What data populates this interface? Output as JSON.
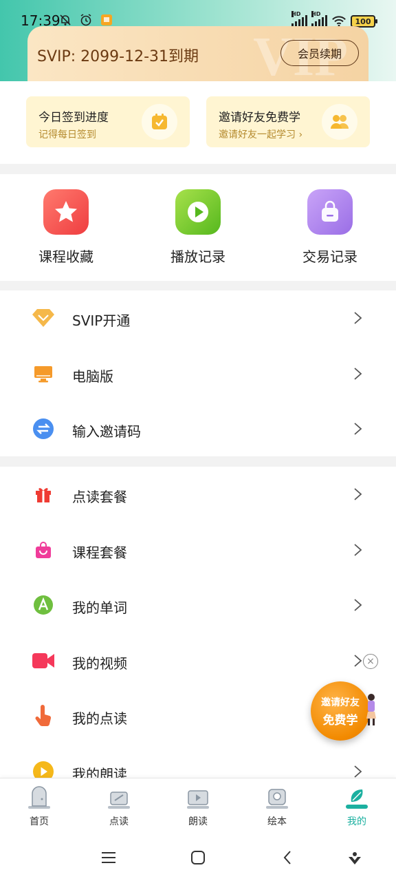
{
  "status_bar": {
    "time": "17:39",
    "hd1": "HD",
    "hd2": "HD",
    "battery": "100"
  },
  "vip": {
    "text": "SVIP: 2099-12-31到期",
    "watermark": "VIP",
    "renew_label": "会员续期"
  },
  "cards": [
    {
      "title": "今日签到进度",
      "sub": "记得每日签到",
      "icon": "calendar-check-icon"
    },
    {
      "title": "邀请好友免费学",
      "sub": "邀请好友一起学习 ›",
      "icon": "friends-icon"
    }
  ],
  "shortcuts": [
    {
      "label": "课程收藏",
      "icon": "star-icon",
      "color": "#f2554f"
    },
    {
      "label": "播放记录",
      "icon": "play-icon",
      "color": "#7fce2e"
    },
    {
      "label": "交易记录",
      "icon": "bag-icon",
      "color": "#b486ee"
    }
  ],
  "menu1": [
    {
      "label": "SVIP开通",
      "icon": "diamond-icon",
      "color": "#f5b84a"
    },
    {
      "label": "电脑版",
      "icon": "monitor-icon",
      "color": "#f59a2a"
    },
    {
      "label": "输入邀请码",
      "icon": "swap-icon",
      "color": "#4a8ff0"
    }
  ],
  "menu2": [
    {
      "label": "点读套餐",
      "icon": "gift-icon",
      "color": "#ef3b33"
    },
    {
      "label": "课程套餐",
      "icon": "shopping-bag-icon",
      "color": "#f03c9a"
    },
    {
      "label": "我的单词",
      "icon": "letter-a-icon",
      "color": "#6fbf3f"
    },
    {
      "label": "我的视频",
      "icon": "video-camera-icon",
      "color": "#f5385a"
    },
    {
      "label": "我的点读",
      "icon": "tap-hand-icon",
      "color": "#f06a3a"
    },
    {
      "label": "我的朗读",
      "icon": "play-circle-icon",
      "color": "#f5b81a"
    }
  ],
  "float": {
    "line1": "邀请好友",
    "line2": "免费学",
    "close": "×"
  },
  "bottom_nav": [
    {
      "label": "首页",
      "icon": "home-icon",
      "active": false
    },
    {
      "label": "点读",
      "icon": "read-icon",
      "active": false
    },
    {
      "label": "朗读",
      "icon": "video-play-icon",
      "active": false
    },
    {
      "label": "绘本",
      "icon": "picture-book-icon",
      "active": false
    },
    {
      "label": "我的",
      "icon": "profile-icon",
      "active": true
    }
  ],
  "colors": {
    "accent": "#1bb0a0",
    "vip_text": "#6b3a12",
    "card_bg": "#fff5d2"
  }
}
